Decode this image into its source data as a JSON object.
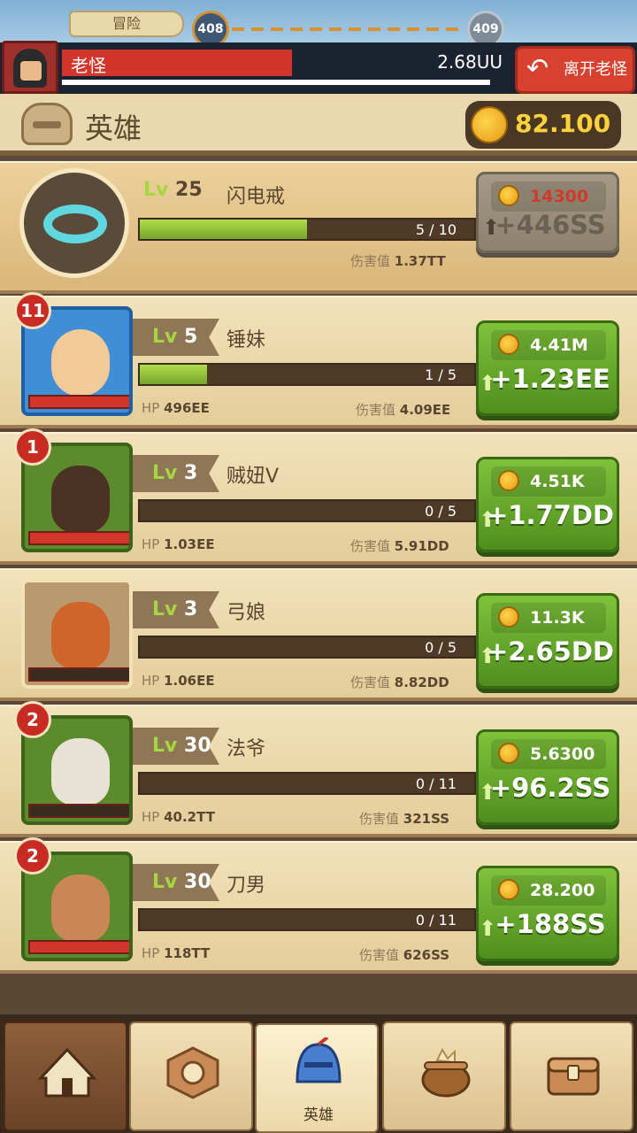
{
  "top": {
    "mode_label": "冒险",
    "current_stage": "408",
    "next_stage": "409",
    "boss_name": "老怪",
    "boss_hp": "2.68UU",
    "leave_label": "离开老怪"
  },
  "header": {
    "title": "英雄",
    "gold": "82.100"
  },
  "item": {
    "lv_prefix": "Lv",
    "level": "25",
    "name": "闪电戒",
    "progress": "5 / 10",
    "progress_fraction": 0.5,
    "dmg_label": "伤害值",
    "dmg": "1.37TT",
    "cost": "14300",
    "gain": "+446SS"
  },
  "heroes": [
    {
      "badge": "11",
      "lv_prefix": "Lv",
      "level": "5",
      "name": "锤妹",
      "progress": "1 / 5",
      "progress_fraction": 0.2,
      "hp_label": "HP",
      "hp": "496EE",
      "dmg_label": "伤害值",
      "dmg": "4.09EE",
      "cost": "4.41M",
      "gain": "+1.23EE"
    },
    {
      "badge": "1",
      "lv_prefix": "Lv",
      "level": "3",
      "name": "贼妞V",
      "progress": "0 / 5",
      "progress_fraction": 0,
      "hp_label": "HP",
      "hp": "1.03EE",
      "dmg_label": "伤害值",
      "dmg": "5.91DD",
      "cost": "4.51K",
      "gain": "+1.77DD"
    },
    {
      "badge": "",
      "lv_prefix": "Lv",
      "level": "3",
      "name": "弓娘",
      "progress": "0 / 5",
      "progress_fraction": 0,
      "hp_label": "HP",
      "hp": "1.06EE",
      "dmg_label": "伤害值",
      "dmg": "8.82DD",
      "cost": "11.3K",
      "gain": "+2.65DD"
    },
    {
      "badge": "2",
      "lv_prefix": "Lv",
      "level": "30",
      "name": "法爷",
      "progress": "0 / 11",
      "progress_fraction": 0,
      "hp_label": "HP",
      "hp": "40.2TT",
      "dmg_label": "伤害值",
      "dmg": "321SS",
      "cost": "5.6300",
      "gain": "+96.2SS"
    },
    {
      "badge": "2",
      "lv_prefix": "Lv",
      "level": "30",
      "name": "刀男",
      "progress": "0 / 11",
      "progress_fraction": 0,
      "hp_label": "HP",
      "hp": "118TT",
      "dmg_label": "伤害值",
      "dmg": "626SS",
      "cost": "28.200",
      "gain": "+188SS"
    }
  ],
  "nav": {
    "items": [
      {
        "icon": "camp-tent-icon"
      },
      {
        "icon": "hexagon-rune-icon"
      },
      {
        "icon": "knight-helmet-icon",
        "label": "英雄"
      },
      {
        "icon": "cauldron-icon"
      },
      {
        "icon": "treasure-chest-icon"
      }
    ]
  },
  "colors": {
    "gold": "#ffd23c",
    "level_green": "#a6d640",
    "hp_red": "#d2352c",
    "button_green": "#7fc33b"
  }
}
